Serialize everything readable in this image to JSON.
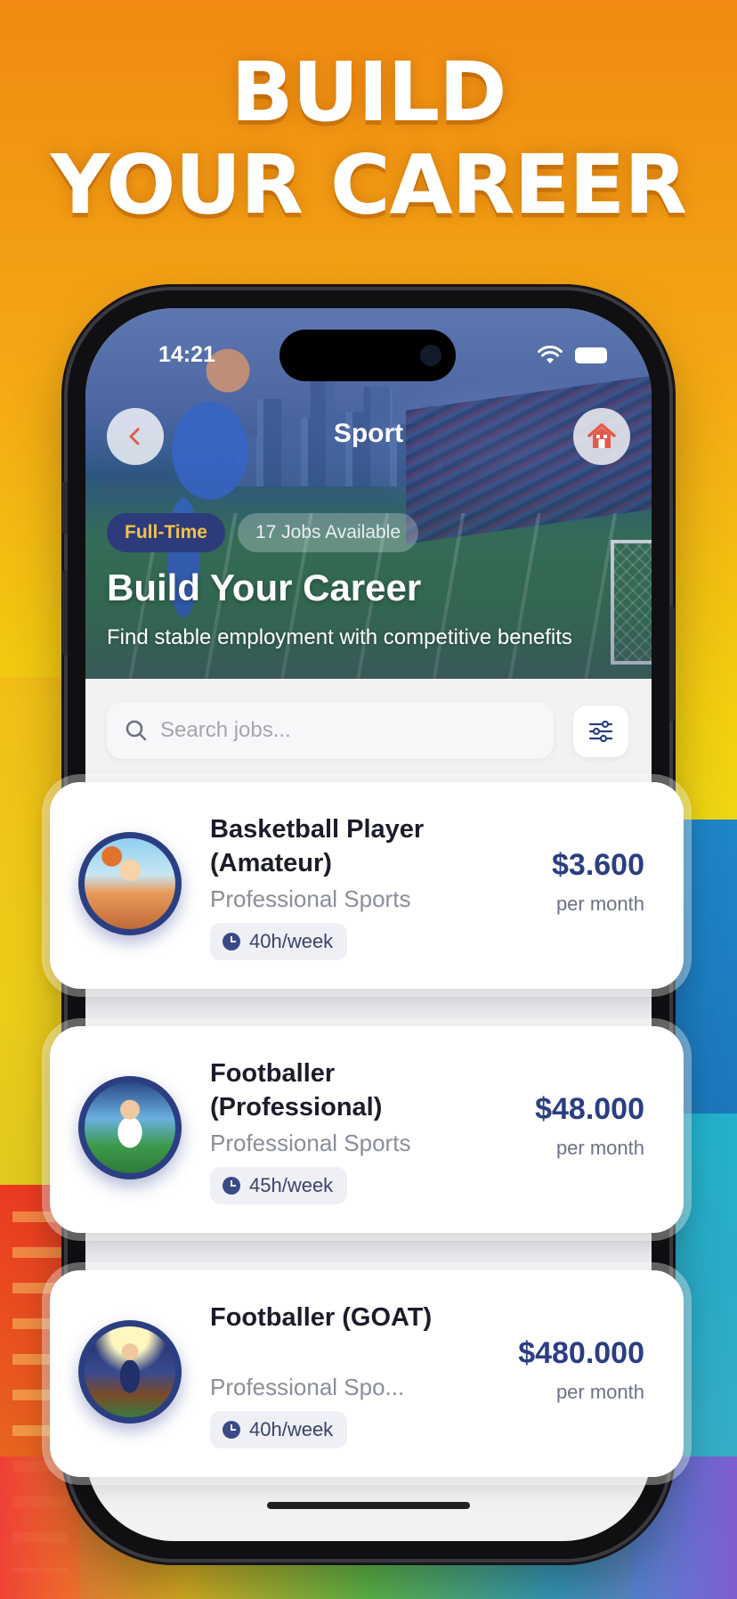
{
  "promo": {
    "headline_line1": "BUILD",
    "headline_line2": "YOUR CAREER"
  },
  "status_bar": {
    "time": "14:21"
  },
  "header": {
    "title": "Sport",
    "back_icon": "chevron-left-icon",
    "home_icon": "home-icon"
  },
  "hero": {
    "chip_type": "Full-Time",
    "chip_count": "17 Jobs Available",
    "title": "Build Your Career",
    "subtitle": "Find stable employment with competitive benefits"
  },
  "search": {
    "placeholder": "Search jobs...",
    "value": ""
  },
  "jobs": [
    {
      "title": "Basketball Player (Amateur)",
      "category": "Professional Sports",
      "hours": "40h/week",
      "salary": "$3.600",
      "period": "per month"
    },
    {
      "title": "Footballer (Professional)",
      "category": "Professional Sports",
      "hours": "45h/week",
      "salary": "$48.000",
      "period": "per month"
    },
    {
      "title": "Footballer (GOAT)",
      "category": "Professional Spo...",
      "hours": "40h/week",
      "salary": "$480.000",
      "period": "per month"
    }
  ],
  "colors": {
    "accent_navy": "#2b3e82",
    "chip_gold": "#f2c24a",
    "home_red": "#e45a48"
  }
}
